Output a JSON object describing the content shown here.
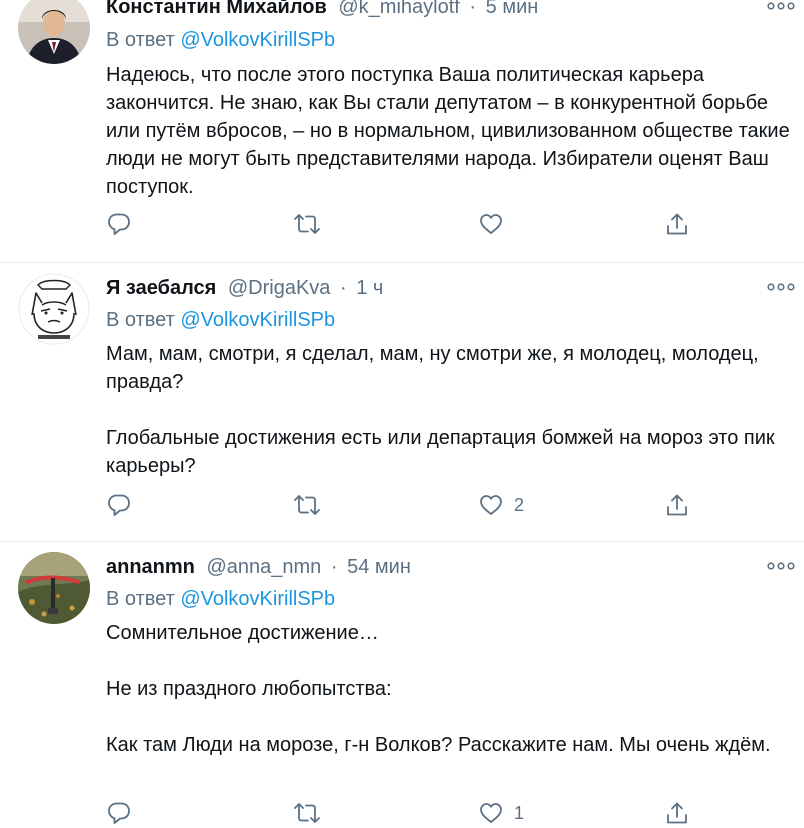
{
  "tweets": [
    {
      "author_name": "Константин Михайлов",
      "handle": "@k_mihaylotf",
      "time": "5 мин",
      "reply_prefix": "В ответ",
      "reply_to": "@VolkovKirillSPb",
      "paragraphs": [
        "Надеюсь, что после этого поступка Ваша политическая карьера закончится. Не знаю, как Вы стали депутатом – в конкурентной борьбе или путём вбросов, – но в нормальном, цивилизованном обществе такие люди не могут быть представителями народа. Избиратели оценят Ваш поступок."
      ],
      "like_count": ""
    },
    {
      "author_name": "Я заебался",
      "handle": "@DrigaKva",
      "time": "1 ч",
      "reply_prefix": "В ответ",
      "reply_to": "@VolkovKirillSPb",
      "paragraphs": [
        "Мам, мам, смотри, я сделал, мам, ну смотри же, я молодец, молодец, правда?",
        "Глобальные достижения есть или департация бомжей на мороз это пик карьеры?"
      ],
      "like_count": "2"
    },
    {
      "author_name": "annanmn",
      "handle": "@anna_nmn",
      "time": "54 мин",
      "reply_prefix": "В ответ",
      "reply_to": "@VolkovKirillSPb",
      "paragraphs": [
        "Сомнительное достижение…",
        "Не из праздного любопытства:",
        "Как там Люди на морозе, г-н Волков? Расскажите нам. Мы очень ждём."
      ],
      "like_count": "1"
    }
  ],
  "header_separator": "·",
  "icons": {
    "more": "more-dots-icon",
    "reply": "reply-bubble-icon",
    "retweet": "retweet-icon",
    "like": "heart-icon",
    "share": "share-icon"
  },
  "colors": {
    "text_primary": "#0f1419",
    "text_secondary": "#5b7083",
    "mention": "#1b95e0",
    "separator": "#e6ecf0"
  }
}
